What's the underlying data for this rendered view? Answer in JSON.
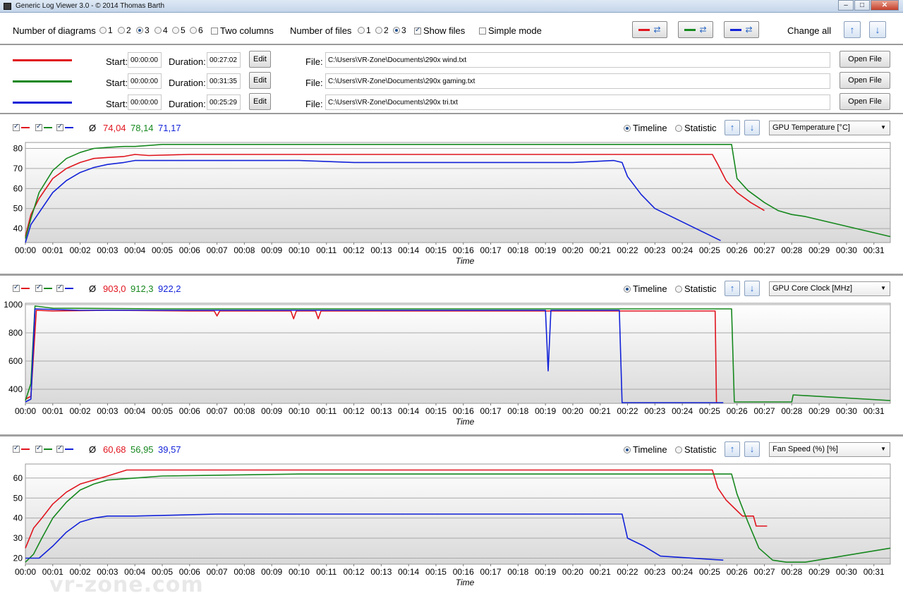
{
  "window": {
    "title": "Generic Log Viewer 3.0 - © 2014 Thomas Barth",
    "minimize": "‒",
    "maximize": "□",
    "close": "✕"
  },
  "toolbar": {
    "num_diagrams_label": "Number of diagrams",
    "diagram_options": [
      "1",
      "2",
      "3",
      "4",
      "5",
      "6"
    ],
    "diagram_selected": "3",
    "two_columns_label": "Two columns",
    "num_files_label": "Number of files",
    "file_options": [
      "1",
      "2",
      "3"
    ],
    "files_selected": "3",
    "show_files_label": "Show files",
    "simple_mode_label": "Simple mode",
    "change_all_label": "Change all",
    "swap_icon": "⇄",
    "up_icon": "↑",
    "down_icon": "↓"
  },
  "colors": {
    "red": "#e0141e",
    "green": "#16881e",
    "blue": "#1222d8"
  },
  "files": [
    {
      "color": "red",
      "start_label": "Start:",
      "start": "00:00:00",
      "duration_label": "Duration:",
      "duration": "00:27:02",
      "edit": "Edit",
      "file_label": "File:",
      "path": "C:\\Users\\VR-Zone\\Documents\\290x wind.txt",
      "open": "Open File"
    },
    {
      "color": "green",
      "start_label": "Start:",
      "start": "00:00:00",
      "duration_label": "Duration:",
      "duration": "00:31:35",
      "edit": "Edit",
      "file_label": "File:",
      "path": "C:\\Users\\VR-Zone\\Documents\\290x gaming.txt",
      "open": "Open File"
    },
    {
      "color": "blue",
      "start_label": "Start:",
      "start": "00:00:00",
      "duration_label": "Duration:",
      "duration": "00:25:29",
      "edit": "Edit",
      "file_label": "File:",
      "path": "C:\\Users\\VR-Zone\\Documents\\290x tri.txt",
      "open": "Open File"
    }
  ],
  "panels": [
    {
      "avg_symbol": "Ø",
      "averages": [
        "74,04",
        "78,14",
        "71,17"
      ],
      "timeline_label": "Timeline",
      "statistic_label": "Statistic",
      "sensor": "GPU Temperature [°C]"
    },
    {
      "avg_symbol": "Ø",
      "averages": [
        "903,0",
        "912,3",
        "922,2"
      ],
      "timeline_label": "Timeline",
      "statistic_label": "Statistic",
      "sensor": "GPU Core Clock [MHz]"
    },
    {
      "avg_symbol": "Ø",
      "averages": [
        "60,68",
        "56,95",
        "39,57"
      ],
      "timeline_label": "Timeline",
      "statistic_label": "Statistic",
      "sensor": "Fan Speed (%) [%]"
    }
  ],
  "watermark": "vr-zone.com",
  "chart_data": [
    {
      "type": "line",
      "title": "GPU Temperature [°C]",
      "xlabel": "Time",
      "ylabel": "",
      "x_ticks": [
        "00:00",
        "00:01",
        "00:02",
        "00:03",
        "00:04",
        "00:05",
        "00:06",
        "00:07",
        "00:08",
        "00:09",
        "00:10",
        "00:11",
        "00:12",
        "00:13",
        "00:14",
        "00:15",
        "00:16",
        "00:17",
        "00:18",
        "00:19",
        "00:20",
        "00:21",
        "00:22",
        "00:23",
        "00:24",
        "00:25",
        "00:26",
        "00:27",
        "00:28",
        "00:29",
        "00:30",
        "00:31"
      ],
      "y_ticks": [
        40,
        50,
        60,
        70,
        80
      ],
      "ylim": [
        33,
        83
      ],
      "xlim": [
        0,
        31.6
      ],
      "series": [
        {
          "name": "290x wind.txt",
          "color": "red",
          "points": [
            [
              0,
              36
            ],
            [
              0.2,
              47
            ],
            [
              0.5,
              55
            ],
            [
              1,
              65
            ],
            [
              1.5,
              70
            ],
            [
              2,
              73
            ],
            [
              2.5,
              75
            ],
            [
              3,
              75.5
            ],
            [
              3.6,
              76
            ],
            [
              4,
              77
            ],
            [
              4.5,
              76.5
            ],
            [
              6,
              77
            ],
            [
              8,
              77
            ],
            [
              10,
              77
            ],
            [
              12,
              77
            ],
            [
              14,
              77
            ],
            [
              16,
              77
            ],
            [
              18,
              77
            ],
            [
              20,
              77
            ],
            [
              22,
              77
            ],
            [
              24,
              77
            ],
            [
              25.1,
              77
            ],
            [
              25.3,
              72
            ],
            [
              25.6,
              64
            ],
            [
              26,
              58
            ],
            [
              26.5,
              53
            ],
            [
              27.0,
              49
            ]
          ]
        },
        {
          "name": "290x gaming.txt",
          "color": "green",
          "points": [
            [
              0,
              35
            ],
            [
              0.2,
              45
            ],
            [
              0.5,
              58
            ],
            [
              1,
              69
            ],
            [
              1.5,
              75
            ],
            [
              2,
              78
            ],
            [
              2.5,
              80
            ],
            [
              3,
              80.5
            ],
            [
              3.6,
              81
            ],
            [
              4,
              81
            ],
            [
              5,
              82
            ],
            [
              10,
              82
            ],
            [
              15,
              82
            ],
            [
              20,
              82
            ],
            [
              25,
              82
            ],
            [
              25.8,
              82
            ],
            [
              26,
              65
            ],
            [
              26.4,
              59
            ],
            [
              27,
              53
            ],
            [
              27.5,
              49
            ],
            [
              28,
              47
            ],
            [
              28.5,
              46
            ],
            [
              31.6,
              36
            ]
          ]
        },
        {
          "name": "290x tri.txt",
          "color": "blue",
          "points": [
            [
              0,
              33
            ],
            [
              0.2,
              42
            ],
            [
              0.5,
              48
            ],
            [
              1,
              58
            ],
            [
              1.5,
              64
            ],
            [
              2,
              68
            ],
            [
              2.5,
              70.5
            ],
            [
              3,
              72
            ],
            [
              3.6,
              73
            ],
            [
              4,
              74
            ],
            [
              6,
              74
            ],
            [
              8,
              74
            ],
            [
              10,
              74
            ],
            [
              12,
              73
            ],
            [
              14,
              73
            ],
            [
              16,
              73
            ],
            [
              18,
              73
            ],
            [
              20,
              73
            ],
            [
              21.5,
              74
            ],
            [
              21.8,
              73
            ],
            [
              22.0,
              66
            ],
            [
              22.5,
              57
            ],
            [
              23,
              50
            ],
            [
              25.4,
              34
            ]
          ]
        }
      ]
    },
    {
      "type": "line",
      "title": "GPU Core Clock [MHz]",
      "xlabel": "Time",
      "ylabel": "",
      "x_ticks": [
        "00:00",
        "00:01",
        "00:02",
        "00:03",
        "00:04",
        "00:05",
        "00:06",
        "00:07",
        "00:08",
        "00:09",
        "00:10",
        "00:11",
        "00:12",
        "00:13",
        "00:14",
        "00:15",
        "00:16",
        "00:17",
        "00:18",
        "00:19",
        "00:20",
        "00:21",
        "00:22",
        "00:23",
        "00:24",
        "00:25",
        "00:26",
        "00:27",
        "00:28",
        "00:29",
        "00:30",
        "00:31"
      ],
      "y_ticks": [
        400,
        600,
        800,
        1000
      ],
      "ylim": [
        300,
        1010
      ],
      "xlim": [
        0,
        31.6
      ],
      "series": [
        {
          "name": "290x wind.txt",
          "color": "red",
          "points": [
            [
              0,
              330
            ],
            [
              0.2,
              350
            ],
            [
              0.4,
              960
            ],
            [
              1,
              955
            ],
            [
              3,
              960
            ],
            [
              6,
              955
            ],
            [
              6.9,
              955
            ],
            [
              7.0,
              920
            ],
            [
              7.1,
              955
            ],
            [
              9.7,
              955
            ],
            [
              9.8,
              900
            ],
            [
              9.9,
              955
            ],
            [
              10.6,
              955
            ],
            [
              10.7,
              900
            ],
            [
              10.8,
              955
            ],
            [
              15,
              955
            ],
            [
              20,
              955
            ],
            [
              25,
              955
            ],
            [
              25.2,
              955
            ],
            [
              25.25,
              305
            ]
          ]
        },
        {
          "name": "290x gaming.txt",
          "color": "green",
          "points": [
            [
              0,
              320
            ],
            [
              0.2,
              440
            ],
            [
              0.35,
              990
            ],
            [
              1,
              975
            ],
            [
              5,
              970
            ],
            [
              10,
              970
            ],
            [
              15,
              970
            ],
            [
              20,
              970
            ],
            [
              25,
              970
            ],
            [
              25.8,
              970
            ],
            [
              25.9,
              310
            ],
            [
              28,
              310
            ],
            [
              28.05,
              360
            ],
            [
              31.6,
              320
            ]
          ]
        },
        {
          "name": "290x tri.txt",
          "color": "blue",
          "points": [
            [
              0,
              310
            ],
            [
              0.2,
              330
            ],
            [
              0.35,
              970
            ],
            [
              2,
              960
            ],
            [
              5,
              960
            ],
            [
              10,
              960
            ],
            [
              15,
              960
            ],
            [
              19,
              960
            ],
            [
              19.1,
              530
            ],
            [
              19.2,
              960
            ],
            [
              21.7,
              960
            ],
            [
              21.8,
              305
            ],
            [
              25.5,
              305
            ]
          ]
        }
      ]
    },
    {
      "type": "line",
      "title": "Fan Speed (%) [%]",
      "xlabel": "Time",
      "ylabel": "",
      "x_ticks": [
        "00:00",
        "00:01",
        "00:02",
        "00:03",
        "00:04",
        "00:05",
        "00:06",
        "00:07",
        "00:08",
        "00:09",
        "00:10",
        "00:11",
        "00:12",
        "00:13",
        "00:14",
        "00:15",
        "00:16",
        "00:17",
        "00:18",
        "00:19",
        "00:20",
        "00:21",
        "00:22",
        "00:23",
        "00:24",
        "00:25",
        "00:26",
        "00:27",
        "00:28",
        "00:29",
        "00:30",
        "00:31"
      ],
      "y_ticks": [
        20,
        30,
        40,
        50,
        60
      ],
      "ylim": [
        17,
        67
      ],
      "xlim": [
        0,
        31.6
      ],
      "series": [
        {
          "name": "290x wind.txt",
          "color": "red",
          "points": [
            [
              0,
              25
            ],
            [
              0.3,
              35
            ],
            [
              0.6,
              40
            ],
            [
              1,
              47
            ],
            [
              1.5,
              53
            ],
            [
              2,
              57
            ],
            [
              2.5,
              59
            ],
            [
              3,
              61
            ],
            [
              3.7,
              64
            ],
            [
              10,
              64
            ],
            [
              15,
              64
            ],
            [
              20,
              64
            ],
            [
              25.1,
              64
            ],
            [
              25.3,
              55
            ],
            [
              25.6,
              49
            ],
            [
              25.9,
              45
            ],
            [
              26.2,
              41
            ],
            [
              26.6,
              41
            ],
            [
              26.7,
              36
            ],
            [
              27.1,
              36
            ]
          ]
        },
        {
          "name": "290x gaming.txt",
          "color": "green",
          "points": [
            [
              0,
              18
            ],
            [
              0.3,
              22
            ],
            [
              0.6,
              30
            ],
            [
              1,
              40
            ],
            [
              1.5,
              48
            ],
            [
              2,
              54
            ],
            [
              2.5,
              57
            ],
            [
              3,
              59
            ],
            [
              4,
              60
            ],
            [
              5,
              61
            ],
            [
              10,
              62
            ],
            [
              15,
              62
            ],
            [
              20,
              62
            ],
            [
              25,
              62
            ],
            [
              25.8,
              62
            ],
            [
              26,
              52
            ],
            [
              26.4,
              38
            ],
            [
              26.8,
              25
            ],
            [
              27.3,
              19
            ],
            [
              27.8,
              18
            ],
            [
              28.5,
              18
            ],
            [
              31.6,
              25
            ]
          ]
        },
        {
          "name": "290x tri.txt",
          "color": "blue",
          "points": [
            [
              0,
              20
            ],
            [
              0.5,
              20
            ],
            [
              1,
              26
            ],
            [
              1.5,
              33
            ],
            [
              2,
              38
            ],
            [
              2.5,
              40
            ],
            [
              3,
              41
            ],
            [
              4,
              41
            ],
            [
              7,
              42
            ],
            [
              10,
              42
            ],
            [
              15,
              42
            ],
            [
              20,
              42
            ],
            [
              21.8,
              42
            ],
            [
              22.0,
              30
            ],
            [
              22.6,
              26
            ],
            [
              23.2,
              21
            ],
            [
              25.5,
              19
            ]
          ]
        }
      ]
    }
  ]
}
